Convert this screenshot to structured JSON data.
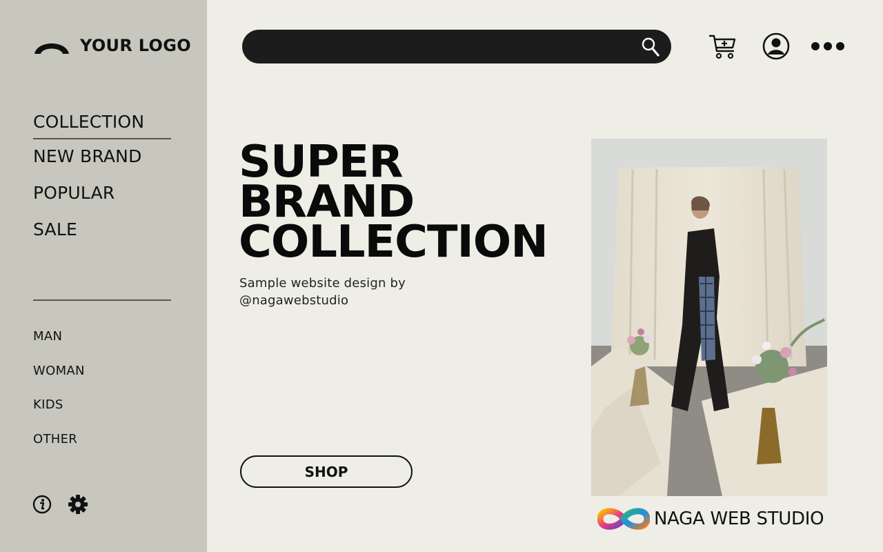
{
  "logo": {
    "text": "YOUR LOGO"
  },
  "sidebar": {
    "main_items": [
      {
        "label": "COLLECTION",
        "active": true
      },
      {
        "label": "NEW BRAND"
      },
      {
        "label": "POPULAR"
      },
      {
        "label": "SALE"
      }
    ],
    "sub_items": [
      {
        "label": "MAN"
      },
      {
        "label": "WOMAN"
      },
      {
        "label": "KIDS"
      },
      {
        "label": "OTHER"
      }
    ],
    "footer_icons": [
      "info-icon",
      "gear-icon"
    ]
  },
  "header": {
    "search": {
      "value": "",
      "placeholder": "",
      "icon": "search-icon"
    },
    "icons": [
      "cart-add-icon",
      "user-icon",
      "more-icon"
    ]
  },
  "hero": {
    "title_line1": "SUPER BRAND",
    "title_line2": "COLLECTION",
    "subtitle_line1": "Sample website design by",
    "subtitle_line2": "@nagawebstudio",
    "shop_label": "SHOP"
  },
  "brand": {
    "text": "NAGA WEB STUDIO"
  },
  "colors": {
    "page_bg": "#eeeee6",
    "sidebar_bg": "#c7c7be",
    "search_bg": "#1c1c1c",
    "text": "#111111"
  }
}
